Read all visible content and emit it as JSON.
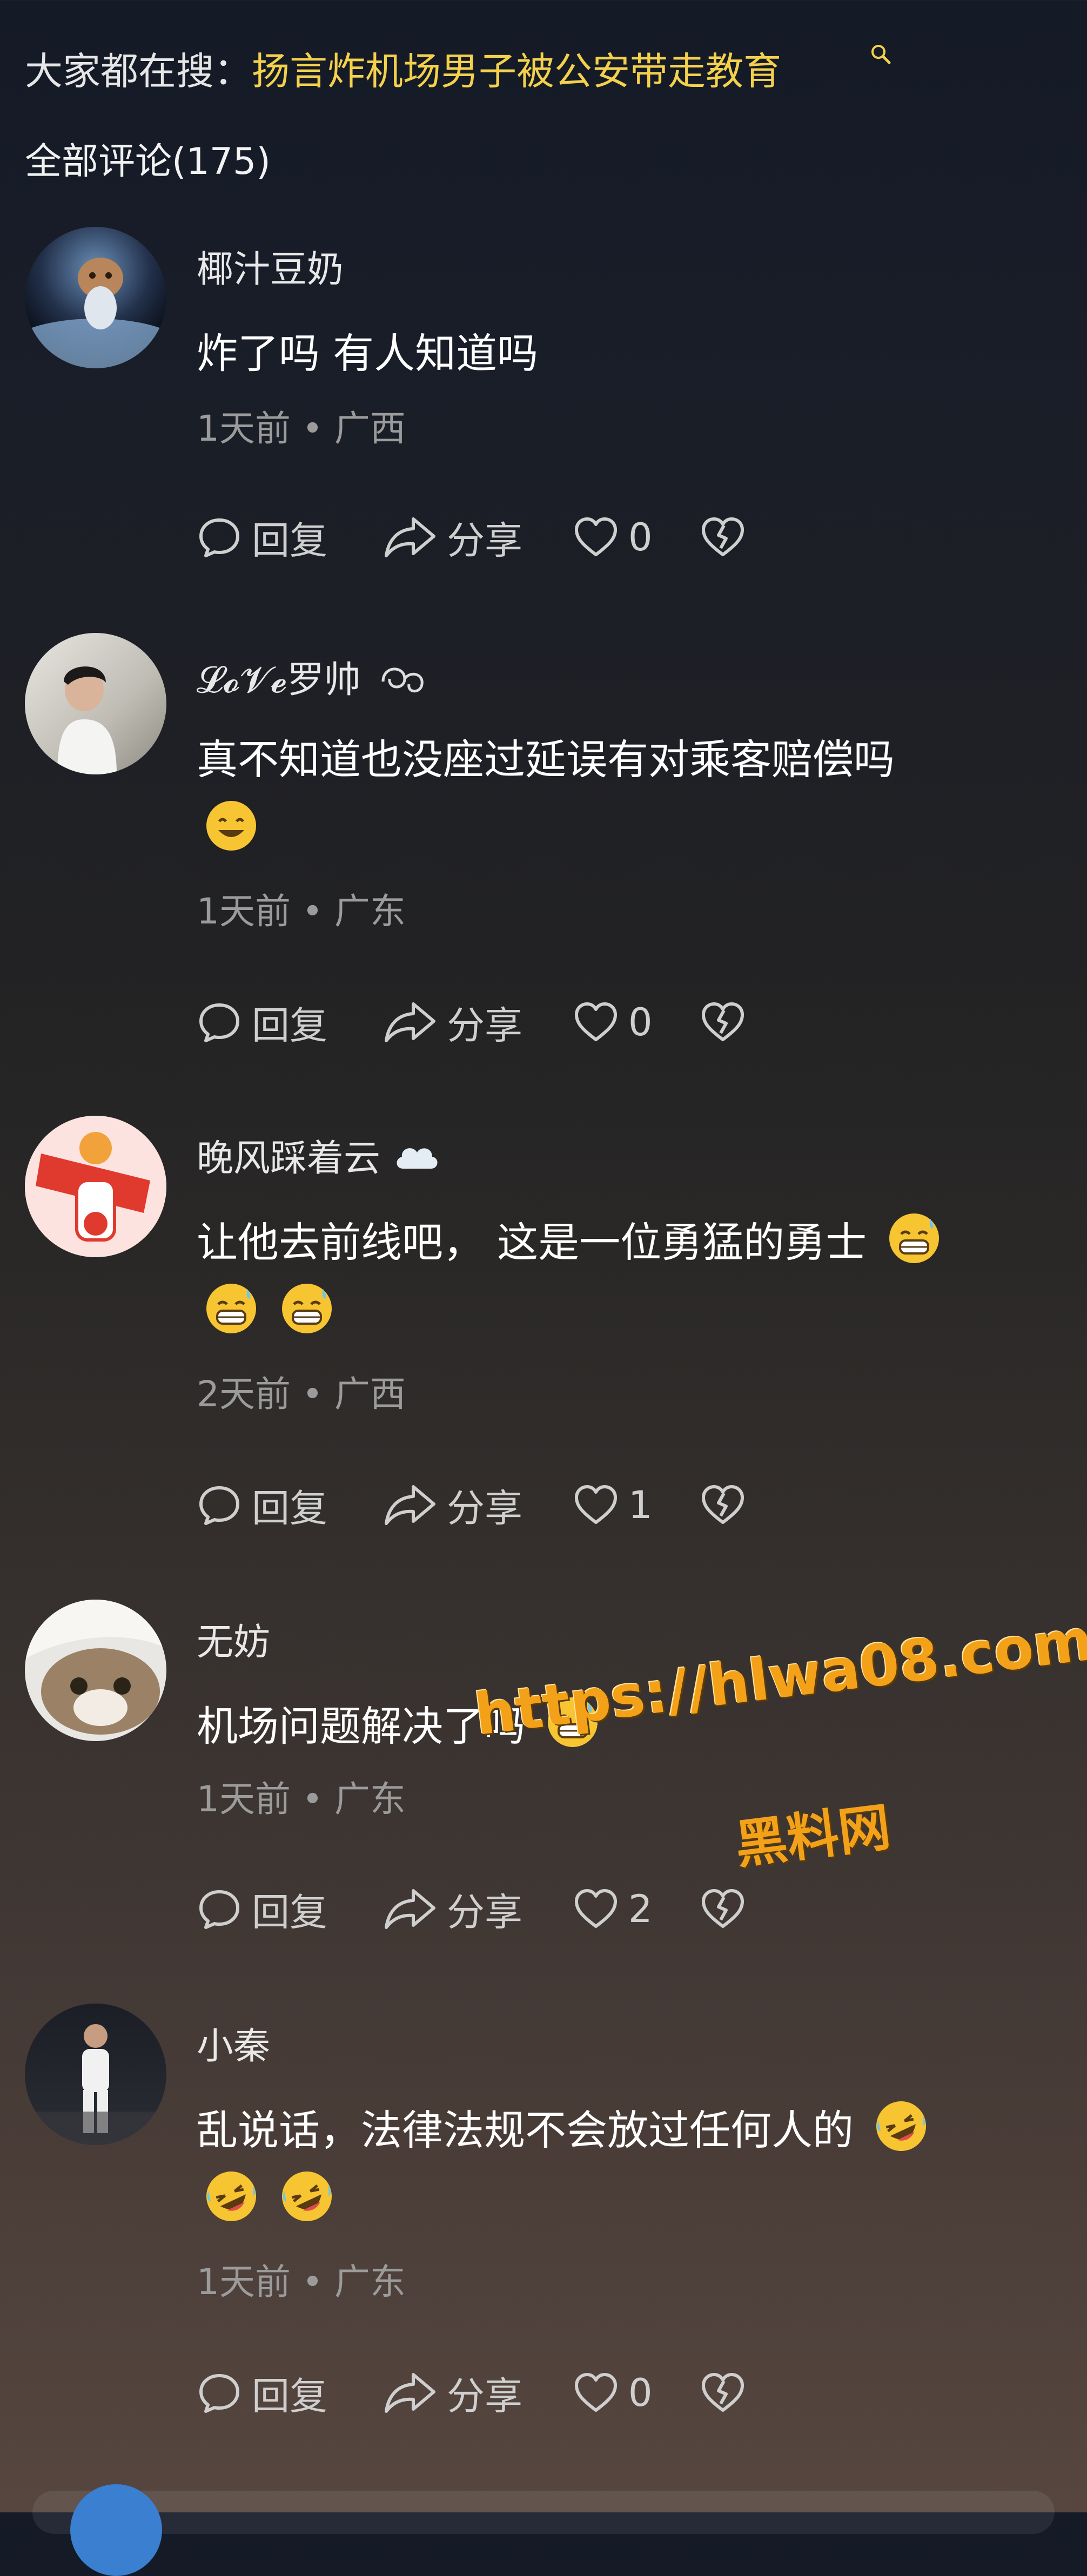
{
  "search": {
    "prefix": "大家都在搜：",
    "link": "扬言炸机场男子被公安带走教育"
  },
  "comments_title": "全部评论(175)",
  "actions": {
    "reply": "回复",
    "share": "分享"
  },
  "colors": {
    "link_yellow": "#f4d14c",
    "watermark": "#f4a11a",
    "meta_gray": "#9b9b9b"
  },
  "comments": [
    {
      "username": "椰汁豆奶",
      "text": "炸了吗 有人知道吗",
      "emojis": [],
      "time_location": "1天前 • 广西",
      "likes": "0",
      "avatar_icon": "astronaut-cat-avatar"
    },
    {
      "username": "𝓛𝓸𝓥𝓮罗帅",
      "text": "真不知道也没座过延误有对乘客赔偿吗",
      "emojis": [
        "smile-emoji"
      ],
      "time_location": "1天前 • 广东",
      "likes": "0",
      "avatar_icon": "young-man-avatar"
    },
    {
      "username": "晚风踩着云",
      "text": "让他去前线吧，  这是一位勇猛的勇士",
      "emojis": [
        "grin-sweat-emoji",
        "grin-sweat-emoji",
        "grin-sweat-emoji"
      ],
      "time_location": "2天前 • 广西",
      "likes": "1",
      "avatar_icon": "cartoon-fortune-avatar",
      "name_suffix_icon": "cloud-icon"
    },
    {
      "username": "无妨",
      "text": "机场问题解决了吗",
      "emojis": [
        "grin-sweat-emoji"
      ],
      "time_location": "1天前 • 广东",
      "likes": "2",
      "avatar_icon": "cat-avatar"
    },
    {
      "username": "小秦",
      "text": "乱说话，法律法规不会放过任何人的",
      "emojis": [
        "rofl-emoji",
        "rofl-emoji",
        "rofl-emoji"
      ],
      "time_location": "1天前 • 广东",
      "likes": "0",
      "avatar_icon": "man-in-white-avatar"
    }
  ],
  "watermark": {
    "url": "https://hlwa08.com",
    "name": "黑料网"
  }
}
